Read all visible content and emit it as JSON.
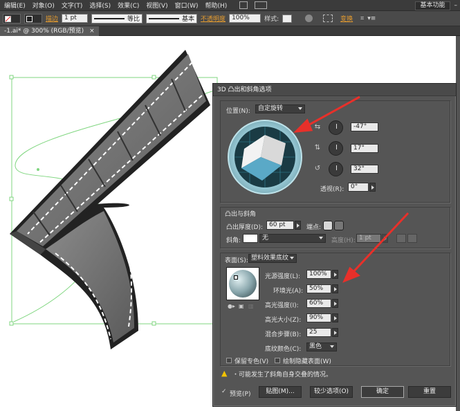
{
  "menu": {
    "items": [
      "编辑(E)",
      "对象(O)",
      "文字(T)",
      "选择(S)",
      "效果(C)",
      "视图(V)",
      "窗口(W)",
      "帮助(H)"
    ],
    "workspace": "基本功能"
  },
  "control_bar": {
    "stroke_label": "描边",
    "stroke_value": "1 pt",
    "profile1": "等比",
    "profile2": "基本",
    "opacity_label": "不透明度",
    "opacity_value": "100%",
    "style_label": "样式:",
    "transform_label": "变换"
  },
  "document_tab": {
    "title": "-1.ai* @ 300% (RGB/预览)",
    "close": "×"
  },
  "dialog": {
    "title": "3D 凸出和斜角选项",
    "position_label": "位置(N):",
    "position_value": "自定旋转",
    "rot_x": "-47°",
    "rot_y": "17°",
    "rot_z": "32°",
    "perspective_label": "透视(R):",
    "perspective_value": "0°",
    "extrude_section": "凸出与斜角",
    "depth_label": "凸出厚度(D):",
    "depth_value": "60 pt",
    "cap_label": "端点:",
    "bevel_label": "斜角:",
    "bevel_value": "无",
    "height_label": "高度(H):",
    "height_value": "1 pt",
    "surface_label": "表面(S):",
    "surface_value": "塑料效果底纹",
    "light_intensity_label": "光源强度(L):",
    "light_intensity": "100%",
    "ambient_label": "环境光(A):",
    "ambient": "50%",
    "highlight_intensity_label": "高光强度(I):",
    "highlight_intensity": "60%",
    "highlight_size_label": "高光大小(Z):",
    "highlight_size": "90%",
    "blend_steps_label": "混合步骤(B):",
    "blend_steps": "25",
    "shade_color_label": "底纹颜色(C):",
    "shade_color": "黑色",
    "preserve_spot": "保留专色(V)",
    "draw_hidden": "绘制隐藏表面(W)",
    "warning": "・可能发生了斜角自身交叠的情况。",
    "preview": "预览(P)",
    "map_btn": "贴图(M)...",
    "fewer_btn": "较少选项(O)",
    "ok_btn": "确定",
    "reset_btn": "重置"
  },
  "colors": {
    "arrow": "#e8302a",
    "guide": "#7fd67f",
    "cube_top": "#5aa9c7"
  }
}
